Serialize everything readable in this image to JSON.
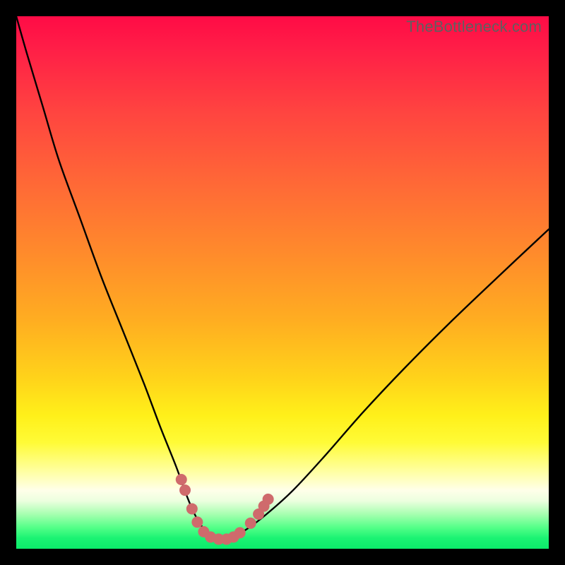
{
  "watermark": "TheBottleneck.com",
  "chart_data": {
    "type": "line",
    "title": "",
    "xlabel": "",
    "ylabel": "",
    "xlim": [
      0,
      100
    ],
    "ylim": [
      0,
      100
    ],
    "grid": false,
    "legend": false,
    "series": [
      {
        "name": "bottleneck-curve",
        "x": [
          0,
          2,
          5,
          8,
          12,
          16,
          20,
          24,
          27,
          30,
          32,
          33.5,
          35,
          36.5,
          38,
          40,
          43,
          47,
          52,
          58,
          65,
          73,
          82,
          92,
          100
        ],
        "y": [
          100,
          93,
          83,
          73,
          62,
          51,
          41,
          31,
          23,
          15.5,
          10,
          6.5,
          4,
          2.5,
          2,
          2.2,
          3.5,
          6.5,
          11,
          17.5,
          25.5,
          34,
          43,
          52.5,
          60
        ],
        "color": "#000000"
      },
      {
        "name": "marker-dots",
        "type": "scatter",
        "points": [
          {
            "x": 31.0,
            "y": 13.0
          },
          {
            "x": 31.7,
            "y": 11.0
          },
          {
            "x": 33.0,
            "y": 7.5
          },
          {
            "x": 34.0,
            "y": 5.0
          },
          {
            "x": 35.2,
            "y": 3.2
          },
          {
            "x": 36.5,
            "y": 2.2
          },
          {
            "x": 38.0,
            "y": 1.8
          },
          {
            "x": 39.5,
            "y": 1.8
          },
          {
            "x": 40.8,
            "y": 2.2
          },
          {
            "x": 42.0,
            "y": 3.0
          },
          {
            "x": 44.0,
            "y": 4.8
          },
          {
            "x": 45.5,
            "y": 6.5
          },
          {
            "x": 46.5,
            "y": 8.0
          },
          {
            "x": 47.3,
            "y": 9.3
          }
        ],
        "color": "#cf6a6c",
        "radius": 8
      }
    ],
    "background_gradient": {
      "type": "vertical",
      "stops": [
        {
          "pos": 0.0,
          "color": "#ff0b46"
        },
        {
          "pos": 0.45,
          "color": "#ff8c2b"
        },
        {
          "pos": 0.8,
          "color": "#fffb36"
        },
        {
          "pos": 0.92,
          "color": "#ecffdf"
        },
        {
          "pos": 1.0,
          "color": "#0beb6a"
        }
      ]
    }
  }
}
